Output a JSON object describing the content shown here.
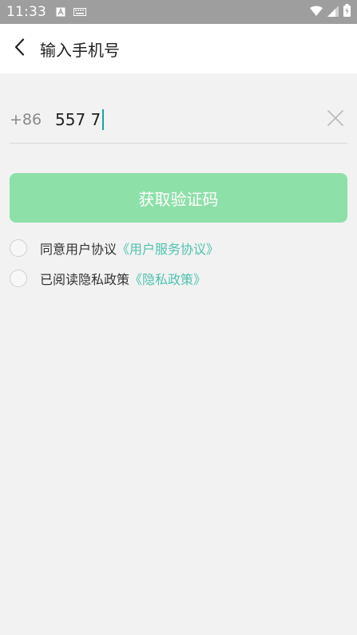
{
  "status_bar": {
    "time": "11:33",
    "icons": [
      "a-notification-icon",
      "keyboard-icon",
      "wifi-icon",
      "signal-icon",
      "battery-icon"
    ]
  },
  "header": {
    "title": "输入手机号"
  },
  "phone": {
    "country_code": "+86",
    "value": "557 7"
  },
  "verify_button": {
    "label": "获取验证码"
  },
  "agreements": {
    "user": {
      "text": "同意用户协议",
      "link": "《用户服务协议》"
    },
    "privacy": {
      "text": "已阅读隐私政策",
      "link": "《隐私政策》"
    }
  },
  "colors": {
    "accent": "#8ee0a9",
    "link": "#4fc3b0",
    "caret": "#1aa39a",
    "status_bar": "#9e9e9e"
  }
}
